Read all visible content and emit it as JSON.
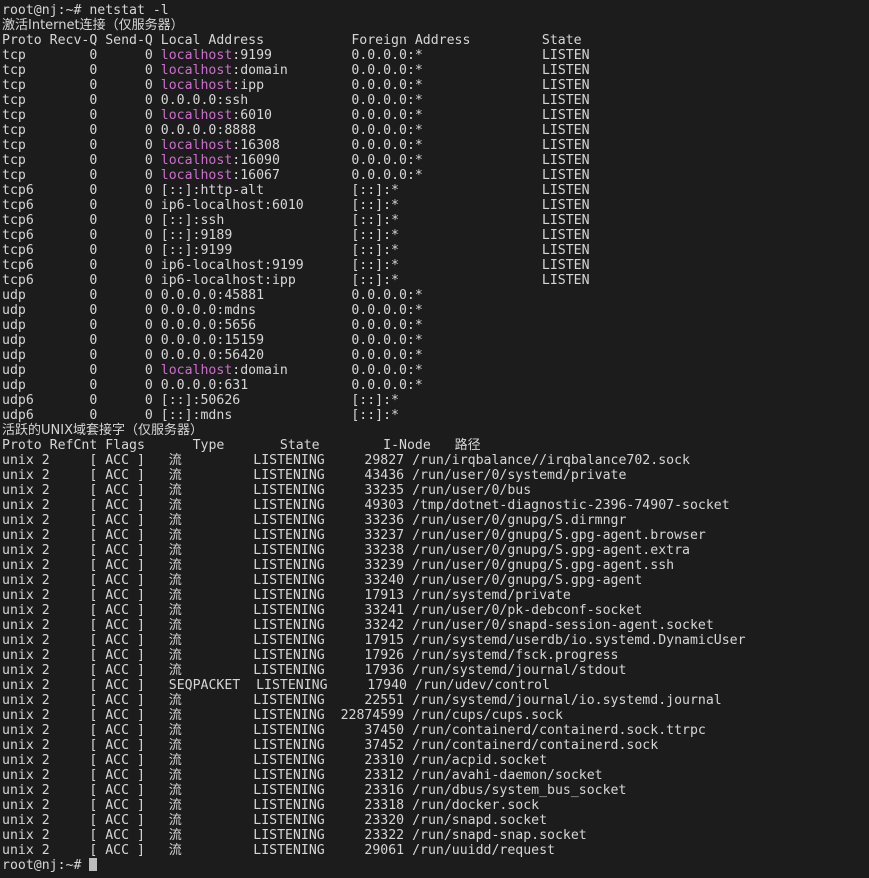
{
  "terminal": {
    "prompt": "root@nj:~# ",
    "command": "netstat -l",
    "trailing_prompt": "root@nj:~# ",
    "colors": {
      "background": "#1c1c1c",
      "foreground": "#d6d6d6",
      "hostname_magenta": "#cc6ecc",
      "cursor": "#bdbdbd"
    }
  },
  "internet_section": {
    "title": "激活Internet连接（仅服务器）",
    "columns": [
      "Proto",
      "Recv-Q",
      "Send-Q",
      "Local Address",
      "Foreign Address",
      "State"
    ],
    "header_line": "Proto Recv-Q Send-Q Local Address           Foreign Address         State",
    "rows": [
      {
        "proto": "tcp",
        "recvq": "0",
        "sendq": "0",
        "local_host": "localhost",
        "local_host_colored": true,
        "local_port": ":9199",
        "foreign": "0.0.0.0:*",
        "state": "LISTEN"
      },
      {
        "proto": "tcp",
        "recvq": "0",
        "sendq": "0",
        "local_host": "localhost",
        "local_host_colored": true,
        "local_port": ":domain",
        "foreign": "0.0.0.0:*",
        "state": "LISTEN"
      },
      {
        "proto": "tcp",
        "recvq": "0",
        "sendq": "0",
        "local_host": "localhost",
        "local_host_colored": true,
        "local_port": ":ipp",
        "foreign": "0.0.0.0:*",
        "state": "LISTEN"
      },
      {
        "proto": "tcp",
        "recvq": "0",
        "sendq": "0",
        "local_host": "0.0.0.0",
        "local_host_colored": false,
        "local_port": ":ssh",
        "foreign": "0.0.0.0:*",
        "state": "LISTEN"
      },
      {
        "proto": "tcp",
        "recvq": "0",
        "sendq": "0",
        "local_host": "localhost",
        "local_host_colored": true,
        "local_port": ":6010",
        "foreign": "0.0.0.0:*",
        "state": "LISTEN"
      },
      {
        "proto": "tcp",
        "recvq": "0",
        "sendq": "0",
        "local_host": "0.0.0.0",
        "local_host_colored": false,
        "local_port": ":8888",
        "foreign": "0.0.0.0:*",
        "state": "LISTEN"
      },
      {
        "proto": "tcp",
        "recvq": "0",
        "sendq": "0",
        "local_host": "localhost",
        "local_host_colored": true,
        "local_port": ":16308",
        "foreign": "0.0.0.0:*",
        "state": "LISTEN"
      },
      {
        "proto": "tcp",
        "recvq": "0",
        "sendq": "0",
        "local_host": "localhost",
        "local_host_colored": true,
        "local_port": ":16090",
        "foreign": "0.0.0.0:*",
        "state": "LISTEN"
      },
      {
        "proto": "tcp",
        "recvq": "0",
        "sendq": "0",
        "local_host": "localhost",
        "local_host_colored": true,
        "local_port": ":16067",
        "foreign": "0.0.0.0:*",
        "state": "LISTEN"
      },
      {
        "proto": "tcp6",
        "recvq": "0",
        "sendq": "0",
        "local_host": "[::]",
        "local_host_colored": false,
        "local_port": ":http-alt",
        "foreign": "[::]:*",
        "state": "LISTEN"
      },
      {
        "proto": "tcp6",
        "recvq": "0",
        "sendq": "0",
        "local_host": "ip6-localhost",
        "local_host_colored": false,
        "local_port": ":6010",
        "foreign": "[::]:*",
        "state": "LISTEN"
      },
      {
        "proto": "tcp6",
        "recvq": "0",
        "sendq": "0",
        "local_host": "[::]",
        "local_host_colored": false,
        "local_port": ":ssh",
        "foreign": "[::]:*",
        "state": "LISTEN"
      },
      {
        "proto": "tcp6",
        "recvq": "0",
        "sendq": "0",
        "local_host": "[::]",
        "local_host_colored": false,
        "local_port": ":9189",
        "foreign": "[::]:*",
        "state": "LISTEN"
      },
      {
        "proto": "tcp6",
        "recvq": "0",
        "sendq": "0",
        "local_host": "[::]",
        "local_host_colored": false,
        "local_port": ":9199",
        "foreign": "[::]:*",
        "state": "LISTEN"
      },
      {
        "proto": "tcp6",
        "recvq": "0",
        "sendq": "0",
        "local_host": "ip6-localhost",
        "local_host_colored": false,
        "local_port": ":9199",
        "foreign": "[::]:*",
        "state": "LISTEN"
      },
      {
        "proto": "tcp6",
        "recvq": "0",
        "sendq": "0",
        "local_host": "ip6-localhost",
        "local_host_colored": false,
        "local_port": ":ipp",
        "foreign": "[::]:*",
        "state": "LISTEN"
      },
      {
        "proto": "udp",
        "recvq": "0",
        "sendq": "0",
        "local_host": "0.0.0.0",
        "local_host_colored": false,
        "local_port": ":45881",
        "foreign": "0.0.0.0:*",
        "state": ""
      },
      {
        "proto": "udp",
        "recvq": "0",
        "sendq": "0",
        "local_host": "0.0.0.0",
        "local_host_colored": false,
        "local_port": ":mdns",
        "foreign": "0.0.0.0:*",
        "state": ""
      },
      {
        "proto": "udp",
        "recvq": "0",
        "sendq": "0",
        "local_host": "0.0.0.0",
        "local_host_colored": false,
        "local_port": ":5656",
        "foreign": "0.0.0.0:*",
        "state": ""
      },
      {
        "proto": "udp",
        "recvq": "0",
        "sendq": "0",
        "local_host": "0.0.0.0",
        "local_host_colored": false,
        "local_port": ":15159",
        "foreign": "0.0.0.0:*",
        "state": ""
      },
      {
        "proto": "udp",
        "recvq": "0",
        "sendq": "0",
        "local_host": "0.0.0.0",
        "local_host_colored": false,
        "local_port": ":56420",
        "foreign": "0.0.0.0:*",
        "state": ""
      },
      {
        "proto": "udp",
        "recvq": "0",
        "sendq": "0",
        "local_host": "localhost",
        "local_host_colored": true,
        "local_port": ":domain",
        "foreign": "0.0.0.0:*",
        "state": ""
      },
      {
        "proto": "udp",
        "recvq": "0",
        "sendq": "0",
        "local_host": "0.0.0.0",
        "local_host_colored": false,
        "local_port": ":631",
        "foreign": "0.0.0.0:*",
        "state": ""
      },
      {
        "proto": "udp6",
        "recvq": "0",
        "sendq": "0",
        "local_host": "[::]",
        "local_host_colored": false,
        "local_port": ":50626",
        "foreign": "[::]:*",
        "state": ""
      },
      {
        "proto": "udp6",
        "recvq": "0",
        "sendq": "0",
        "local_host": "[::]",
        "local_host_colored": false,
        "local_port": ":mdns",
        "foreign": "[::]:*",
        "state": ""
      }
    ]
  },
  "unix_section": {
    "title": "活跃的UNIX域套接字（仅服务器）",
    "columns": [
      "Proto",
      "RefCnt",
      "Flags",
      "Type",
      "State",
      "I-Node",
      "路径"
    ],
    "rows": [
      {
        "proto": "unix",
        "refcnt": "2",
        "flags": "[ ACC ]",
        "type": "流",
        "state": "LISTENING",
        "inode": "29827",
        "path": "/run/irqbalance//irqbalance702.sock"
      },
      {
        "proto": "unix",
        "refcnt": "2",
        "flags": "[ ACC ]",
        "type": "流",
        "state": "LISTENING",
        "inode": "43436",
        "path": "/run/user/0/systemd/private"
      },
      {
        "proto": "unix",
        "refcnt": "2",
        "flags": "[ ACC ]",
        "type": "流",
        "state": "LISTENING",
        "inode": "33235",
        "path": "/run/user/0/bus"
      },
      {
        "proto": "unix",
        "refcnt": "2",
        "flags": "[ ACC ]",
        "type": "流",
        "state": "LISTENING",
        "inode": "49303",
        "path": "/tmp/dotnet-diagnostic-2396-74907-socket"
      },
      {
        "proto": "unix",
        "refcnt": "2",
        "flags": "[ ACC ]",
        "type": "流",
        "state": "LISTENING",
        "inode": "33236",
        "path": "/run/user/0/gnupg/S.dirmngr"
      },
      {
        "proto": "unix",
        "refcnt": "2",
        "flags": "[ ACC ]",
        "type": "流",
        "state": "LISTENING",
        "inode": "33237",
        "path": "/run/user/0/gnupg/S.gpg-agent.browser"
      },
      {
        "proto": "unix",
        "refcnt": "2",
        "flags": "[ ACC ]",
        "type": "流",
        "state": "LISTENING",
        "inode": "33238",
        "path": "/run/user/0/gnupg/S.gpg-agent.extra"
      },
      {
        "proto": "unix",
        "refcnt": "2",
        "flags": "[ ACC ]",
        "type": "流",
        "state": "LISTENING",
        "inode": "33239",
        "path": "/run/user/0/gnupg/S.gpg-agent.ssh"
      },
      {
        "proto": "unix",
        "refcnt": "2",
        "flags": "[ ACC ]",
        "type": "流",
        "state": "LISTENING",
        "inode": "33240",
        "path": "/run/user/0/gnupg/S.gpg-agent"
      },
      {
        "proto": "unix",
        "refcnt": "2",
        "flags": "[ ACC ]",
        "type": "流",
        "state": "LISTENING",
        "inode": "17913",
        "path": "/run/systemd/private"
      },
      {
        "proto": "unix",
        "refcnt": "2",
        "flags": "[ ACC ]",
        "type": "流",
        "state": "LISTENING",
        "inode": "33241",
        "path": "/run/user/0/pk-debconf-socket"
      },
      {
        "proto": "unix",
        "refcnt": "2",
        "flags": "[ ACC ]",
        "type": "流",
        "state": "LISTENING",
        "inode": "33242",
        "path": "/run/user/0/snapd-session-agent.socket"
      },
      {
        "proto": "unix",
        "refcnt": "2",
        "flags": "[ ACC ]",
        "type": "流",
        "state": "LISTENING",
        "inode": "17915",
        "path": "/run/systemd/userdb/io.systemd.DynamicUser"
      },
      {
        "proto": "unix",
        "refcnt": "2",
        "flags": "[ ACC ]",
        "type": "流",
        "state": "LISTENING",
        "inode": "17926",
        "path": "/run/systemd/fsck.progress"
      },
      {
        "proto": "unix",
        "refcnt": "2",
        "flags": "[ ACC ]",
        "type": "流",
        "state": "LISTENING",
        "inode": "17936",
        "path": "/run/systemd/journal/stdout"
      },
      {
        "proto": "unix",
        "refcnt": "2",
        "flags": "[ ACC ]",
        "type": "SEQPACKET",
        "state": "LISTENING",
        "inode": "17940",
        "path": "/run/udev/control"
      },
      {
        "proto": "unix",
        "refcnt": "2",
        "flags": "[ ACC ]",
        "type": "流",
        "state": "LISTENING",
        "inode": "22551",
        "path": "/run/systemd/journal/io.systemd.journal"
      },
      {
        "proto": "unix",
        "refcnt": "2",
        "flags": "[ ACC ]",
        "type": "流",
        "state": "LISTENING",
        "inode": "22874599",
        "path": "/run/cups/cups.sock"
      },
      {
        "proto": "unix",
        "refcnt": "2",
        "flags": "[ ACC ]",
        "type": "流",
        "state": "LISTENING",
        "inode": "37450",
        "path": "/run/containerd/containerd.sock.ttrpc"
      },
      {
        "proto": "unix",
        "refcnt": "2",
        "flags": "[ ACC ]",
        "type": "流",
        "state": "LISTENING",
        "inode": "37452",
        "path": "/run/containerd/containerd.sock"
      },
      {
        "proto": "unix",
        "refcnt": "2",
        "flags": "[ ACC ]",
        "type": "流",
        "state": "LISTENING",
        "inode": "23310",
        "path": "/run/acpid.socket"
      },
      {
        "proto": "unix",
        "refcnt": "2",
        "flags": "[ ACC ]",
        "type": "流",
        "state": "LISTENING",
        "inode": "23312",
        "path": "/run/avahi-daemon/socket"
      },
      {
        "proto": "unix",
        "refcnt": "2",
        "flags": "[ ACC ]",
        "type": "流",
        "state": "LISTENING",
        "inode": "23316",
        "path": "/run/dbus/system_bus_socket"
      },
      {
        "proto": "unix",
        "refcnt": "2",
        "flags": "[ ACC ]",
        "type": "流",
        "state": "LISTENING",
        "inode": "23318",
        "path": "/run/docker.sock"
      },
      {
        "proto": "unix",
        "refcnt": "2",
        "flags": "[ ACC ]",
        "type": "流",
        "state": "LISTENING",
        "inode": "23320",
        "path": "/run/snapd.socket"
      },
      {
        "proto": "unix",
        "refcnt": "2",
        "flags": "[ ACC ]",
        "type": "流",
        "state": "LISTENING",
        "inode": "23322",
        "path": "/run/snapd-snap.socket"
      },
      {
        "proto": "unix",
        "refcnt": "2",
        "flags": "[ ACC ]",
        "type": "流",
        "state": "LISTENING",
        "inode": "29061",
        "path": "/run/uuidd/request"
      }
    ]
  }
}
